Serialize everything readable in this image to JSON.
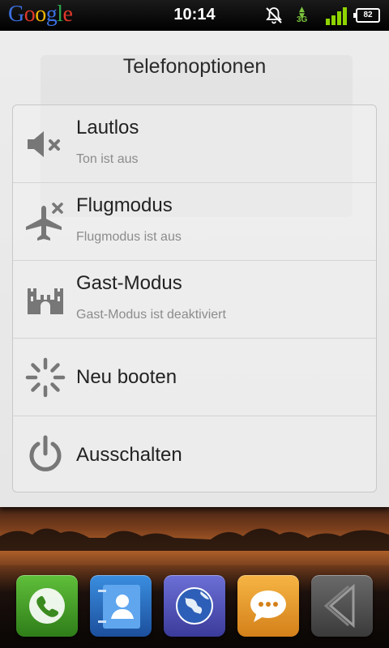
{
  "status_bar": {
    "logo": "Google",
    "time": "10:14",
    "network": "3G",
    "battery": "82",
    "icons": [
      "notifications-muted-icon",
      "network-3g-icon",
      "signal-strength-icon",
      "battery-icon"
    ]
  },
  "dialog": {
    "title": "Telefonoptionen",
    "options": [
      {
        "title": "Lautlos",
        "subtitle": "Ton ist aus",
        "icon": "speaker-muted-icon"
      },
      {
        "title": "Flugmodus",
        "subtitle": "Flugmodus ist aus",
        "icon": "airplane-icon"
      },
      {
        "title": "Gast-Modus",
        "subtitle": "Gast-Modus ist deaktiviert",
        "icon": "castle-icon"
      },
      {
        "title": "Neu booten",
        "icon": "reboot-spinner-icon"
      },
      {
        "title": "Ausschalten",
        "icon": "power-icon"
      }
    ]
  },
  "dock": {
    "items": [
      "phone-icon",
      "contacts-icon",
      "browser-icon",
      "messages-icon",
      "back-icon"
    ]
  },
  "colors": {
    "dialog_bg": "#ececec",
    "signal_green": "#8fd400",
    "title_text": "#222222",
    "subtitle_text": "#8c8c8c"
  }
}
